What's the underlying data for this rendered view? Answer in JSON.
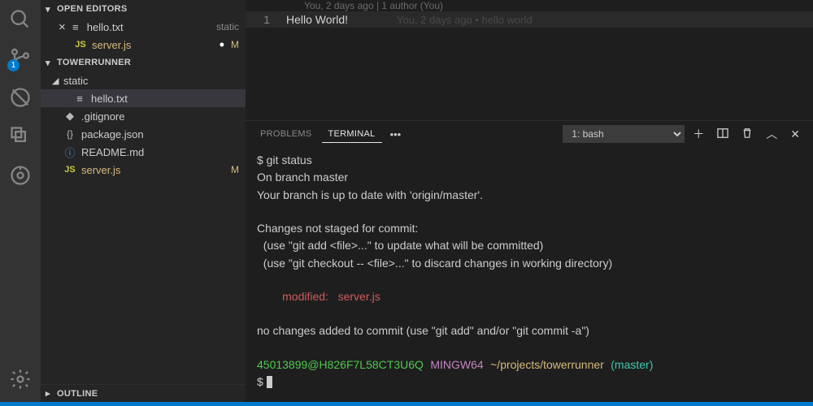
{
  "activity": {
    "scm_badge": "1"
  },
  "sidebar": {
    "sections": {
      "openEditors": {
        "title": "OPEN EDITORS"
      },
      "project": {
        "title": "TOWERRUNNER"
      },
      "outline": {
        "title": "OUTLINE"
      }
    },
    "openEditors": [
      {
        "name": "hello.txt",
        "desc": "static",
        "close": "×",
        "icon": "≡",
        "iconClass": "doc"
      },
      {
        "name": "server.js",
        "modified": "M",
        "icon": "JS",
        "iconClass": "js",
        "dirty": true
      }
    ],
    "tree": [
      {
        "name": "static",
        "folder": true,
        "depth": 0,
        "expanded": true
      },
      {
        "name": "hello.txt",
        "depth": 1,
        "icon": "≡",
        "iconClass": "doc",
        "selected": true
      },
      {
        "name": ".gitignore",
        "depth": 0,
        "icon": "◆",
        "iconClass": "br"
      },
      {
        "name": "package.json",
        "depth": 0,
        "icon": "{}",
        "iconClass": "br"
      },
      {
        "name": "README.md",
        "depth": 0,
        "icon": "ⓘ",
        "iconClass": "info"
      },
      {
        "name": "server.js",
        "depth": 0,
        "icon": "JS",
        "iconClass": "js",
        "modified": "M"
      }
    ]
  },
  "editor": {
    "blame": "You, 2 days ago | 1 author (You)",
    "lineNumber": "1",
    "lineText": "Hello World!",
    "inlineBlame": "You, 2 days ago • hello world"
  },
  "panel": {
    "tabs": {
      "problems": "PROBLEMS",
      "terminal": "TERMINAL"
    },
    "terminalSelector": "1: bash",
    "terminal": {
      "l1": "$ git status",
      "l2": "On branch master",
      "l3": "Your branch is up to date with 'origin/master'.",
      "l4": "Changes not staged for commit:",
      "l5": "  (use \"git add <file>...\" to update what will be committed)",
      "l6": "  (use \"git checkout -- <file>...\" to discard changes in working directory)",
      "l7": "        modified:   server.js",
      "l8": "no changes added to commit (use \"git add\" and/or \"git commit -a\")",
      "prompt": {
        "user": "45013899@H826F7L58CT3U6Q",
        "sys": "MINGW64",
        "path": "~/projects/towerrunner",
        "branch": "(master)"
      },
      "ps": "$ "
    }
  }
}
